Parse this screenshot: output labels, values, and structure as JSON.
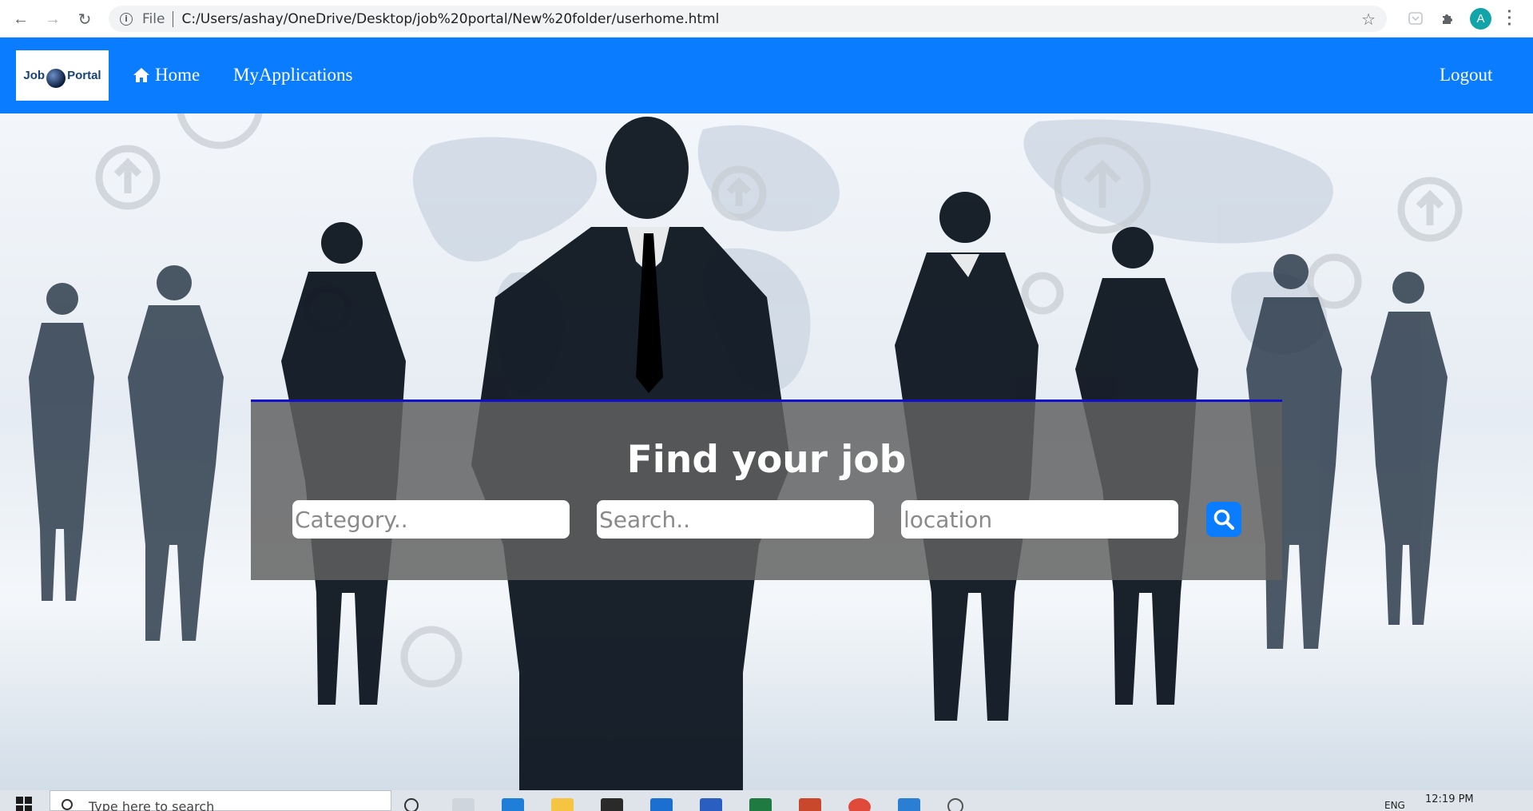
{
  "browser": {
    "file_label": "File",
    "url": "C:/Users/ashay/OneDrive/Desktop/job%20portal/New%20folder/userhome.html",
    "profile_initial": "A"
  },
  "navbar": {
    "logo_left": "Job",
    "logo_right": "Portal",
    "home_label": "Home",
    "applications_label": "MyApplications",
    "logout_label": "Logout",
    "bg_color": "#0a7cff"
  },
  "search_panel": {
    "title": "Find your job",
    "category_placeholder": "Category..",
    "search_placeholder": "Search..",
    "location_placeholder": "location",
    "search_button_icon": "search-icon"
  },
  "taskbar": {
    "search_placeholder": "Type here to search",
    "time": "12:19 PM",
    "language": "ENG"
  }
}
